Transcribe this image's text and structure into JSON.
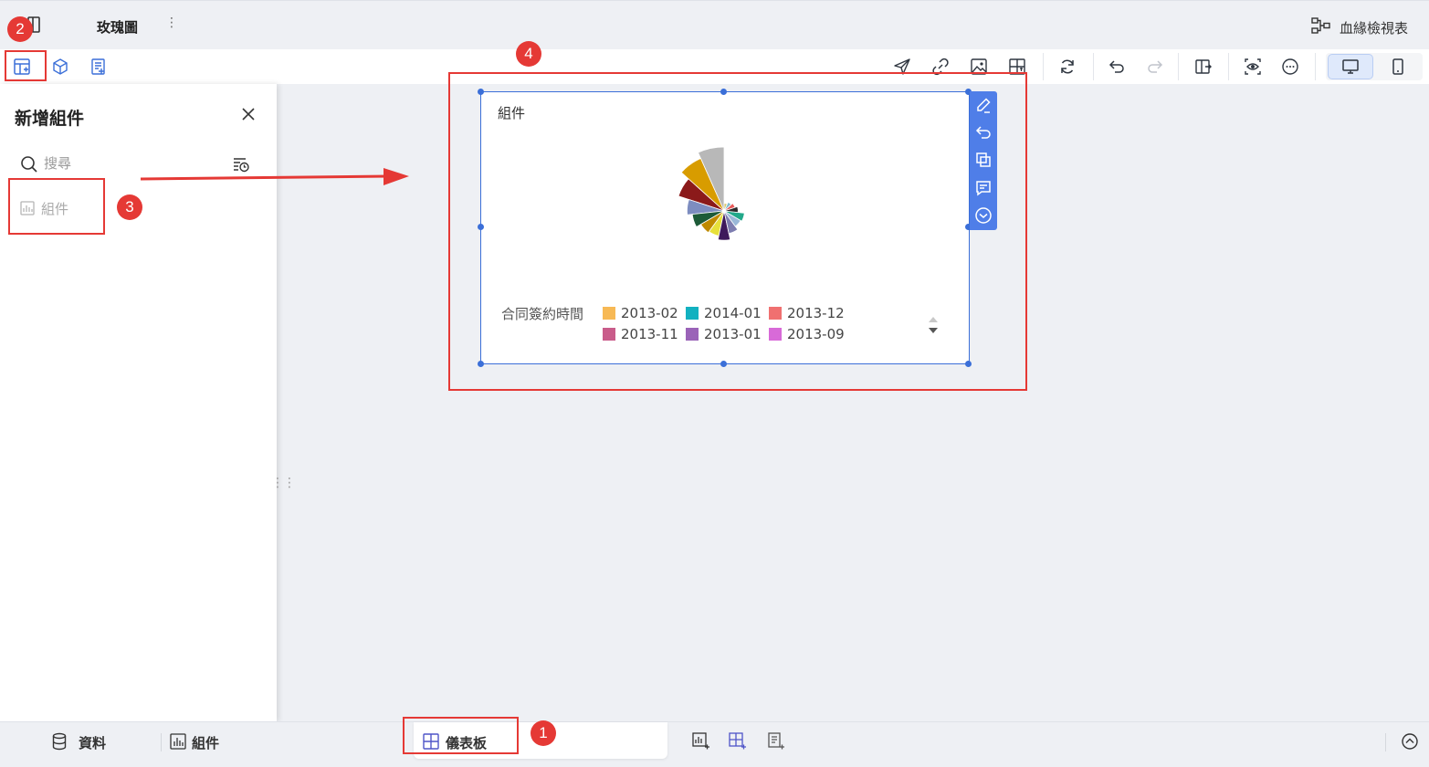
{
  "header": {
    "title": "玫瑰圖",
    "more": "⋮",
    "lineage_label": "血緣檢視表"
  },
  "toolbar": {
    "icons": [
      "send-icon",
      "link-icon",
      "image-icon",
      "grid-icon",
      "refresh-icon",
      "undo-icon",
      "redo-icon",
      "split-icon",
      "preview-icon",
      "more-icon",
      "desktop-icon",
      "mobile-icon"
    ],
    "left_icons": [
      "add-component-icon",
      "cube-icon",
      "add-report-icon"
    ]
  },
  "panel": {
    "title": "新增組件",
    "search_placeholder": "搜尋",
    "items": [
      {
        "label": "組件"
      }
    ]
  },
  "widget": {
    "title": "組件",
    "legend_title": "合同簽約時間",
    "legend": [
      {
        "label": "2013-02",
        "color": "#f7b955"
      },
      {
        "label": "2014-01",
        "color": "#12b1c0"
      },
      {
        "label": "2013-12",
        "color": "#f07070"
      },
      {
        "label": "2013-11",
        "color": "#c95c8a"
      },
      {
        "label": "2013-01",
        "color": "#9a63b8"
      },
      {
        "label": "2013-09",
        "color": "#d86ad8"
      }
    ],
    "toolbar_icons": [
      "edit-icon",
      "undo-icon",
      "copy-icon",
      "comment-icon",
      "more-down-icon"
    ]
  },
  "chart_data": {
    "type": "pie",
    "variant": "rose",
    "slices": [
      {
        "color": "#b8b8b8",
        "value": 1.0
      },
      {
        "color": "#d89c00",
        "value": 0.9
      },
      {
        "color": "#8b1a1a",
        "value": 0.75
      },
      {
        "color": "#7d8dc0",
        "value": 0.58
      },
      {
        "color": "#1d5b38",
        "value": 0.5
      },
      {
        "color": "#bf8a00",
        "value": 0.42
      },
      {
        "color": "#e7e03a",
        "value": 0.4
      },
      {
        "color": "#3e1a5c",
        "value": 0.46
      },
      {
        "color": "#7d7db0",
        "value": 0.36
      },
      {
        "color": "#9ab8d8",
        "value": 0.3
      },
      {
        "color": "#22a88a",
        "value": 0.32
      },
      {
        "color": "#2a2a2a",
        "value": 0.22
      },
      {
        "color": "#e85a5a",
        "value": 0.18
      },
      {
        "color": "#7fbbd0",
        "value": 0.15
      },
      {
        "color": "#d8c870",
        "value": 0.12
      }
    ]
  },
  "bottom": {
    "data_tab": "資料",
    "component_tab": "組件",
    "dashboard_tab": "儀表板"
  },
  "annotations": [
    "1",
    "2",
    "3",
    "4"
  ]
}
